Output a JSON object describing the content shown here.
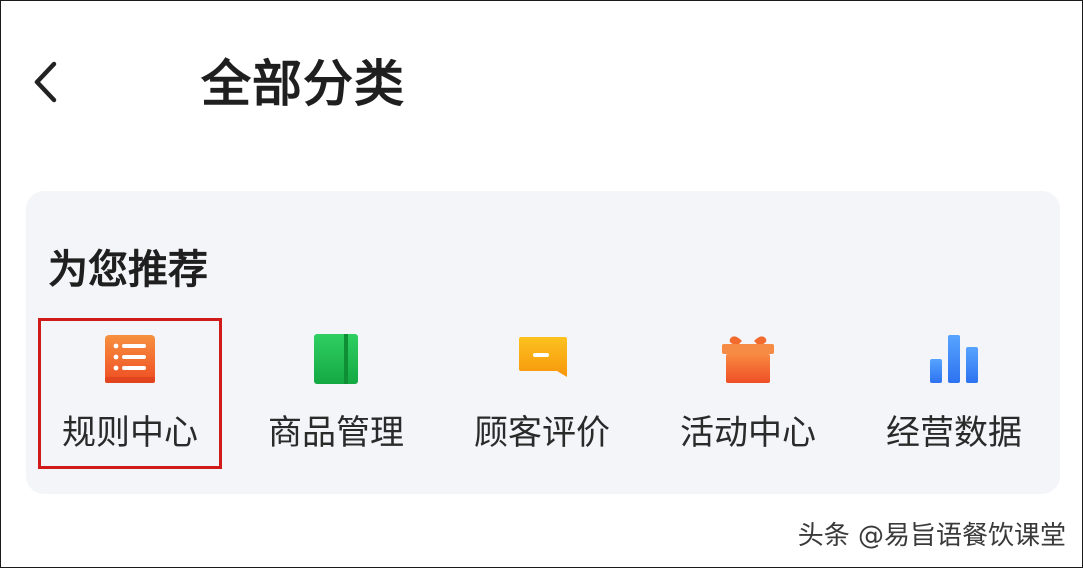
{
  "header": {
    "back_icon": "chevron-left-icon",
    "title": "全部分类"
  },
  "recommend": {
    "title": "为您推荐",
    "items": [
      {
        "label": "规则中心",
        "icon": "rules-list-icon",
        "color": "#f05a28",
        "highlighted": true
      },
      {
        "label": "商品管理",
        "icon": "product-book-icon",
        "color": "#17b34a",
        "highlighted": false
      },
      {
        "label": "顾客评价",
        "icon": "review-chat-icon",
        "color": "#f9a10d",
        "highlighted": false
      },
      {
        "label": "活动中心",
        "icon": "gift-icon",
        "color": "#f25c2a",
        "highlighted": false
      },
      {
        "label": "经营数据",
        "icon": "bar-chart-icon",
        "color": "#2f7cf6",
        "highlighted": false
      }
    ]
  },
  "highlight_color": "#d11a1a",
  "watermark": "头条 @易旨语餐饮课堂"
}
